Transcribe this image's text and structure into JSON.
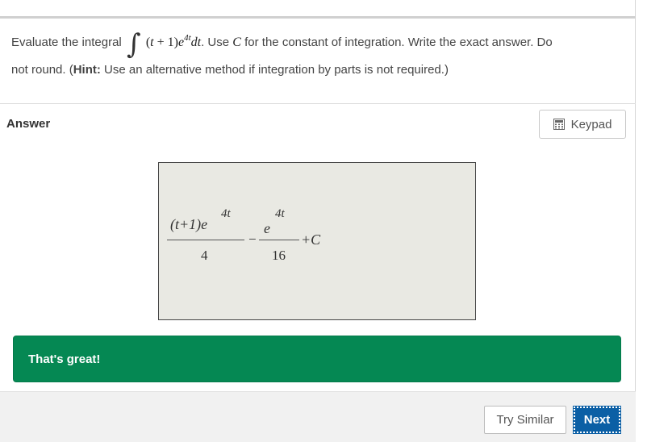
{
  "question": {
    "prefix": "Evaluate the integral",
    "integrand": "(t + 1)e",
    "exponent": "4t",
    "differential": "dt",
    "mid": ". Use",
    "constant": "C",
    "suffix": "for the constant of integration. Write the exact answer. Do",
    "line2_start": "not round. (",
    "hint_label": "Hint:",
    "hint_text": "Use an alternative method if integration by parts is not required.)"
  },
  "answer": {
    "label": "Answer",
    "keypad_label": "Keypad",
    "expression": {
      "term1_numerator": "(t+1)e",
      "term1_exponent": "4t",
      "term1_denominator": "4",
      "minus": "−",
      "term2_numerator": "e",
      "term2_exponent": "4t",
      "term2_denominator": "16",
      "plus_c": "+C"
    }
  },
  "feedback": {
    "text": "That's great!",
    "color": "#058853"
  },
  "footer": {
    "try_similar_label": "Try Similar",
    "next_label": "Next",
    "next_color": "#0b5fa5"
  },
  "icons": {
    "keypad": "calculator-icon",
    "integral": "integral-sign"
  }
}
